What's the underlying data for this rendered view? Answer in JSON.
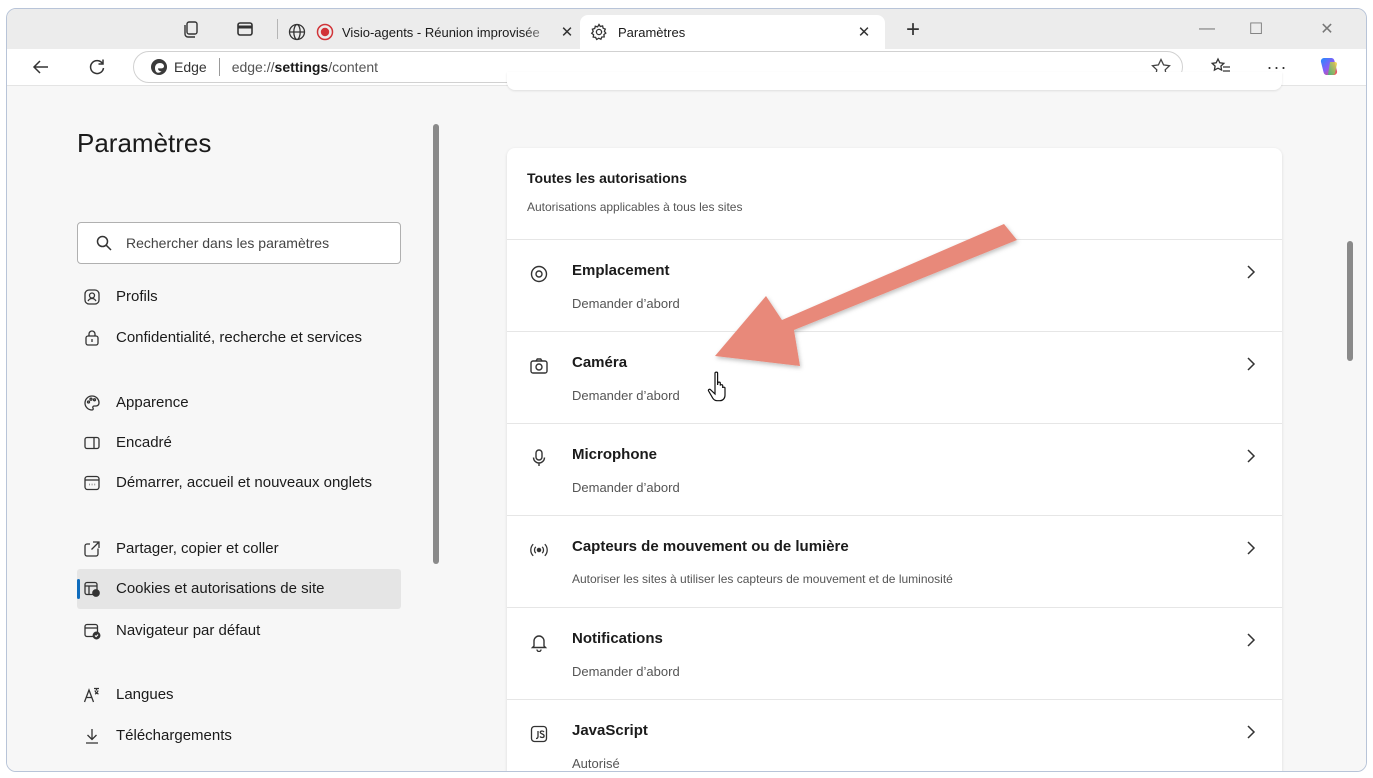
{
  "tabs": [
    {
      "title": "Visio-agents - Réunion improvisée",
      "active": false
    },
    {
      "title": "Paramètres",
      "active": true
    }
  ],
  "toolbar": {
    "omnibox_brand": "Edge",
    "url_prefix": "edge://",
    "url_bold": "settings",
    "url_suffix": "/content"
  },
  "sidebar": {
    "title": "Paramètres",
    "search_placeholder": "Rechercher dans les paramètres",
    "items": [
      {
        "label": "Profils",
        "icon": "profile-icon"
      },
      {
        "label": "Confidentialité, recherche et services",
        "icon": "lock-icon"
      },
      {
        "label": "Apparence",
        "icon": "palette-icon"
      },
      {
        "label": "Encadré",
        "icon": "sidebar-panel-icon"
      },
      {
        "label": "Démarrer, accueil et nouveaux onglets",
        "icon": "home-tab-icon"
      },
      {
        "label": "Partager, copier et coller",
        "icon": "share-icon"
      },
      {
        "label": "Cookies et autorisations de site",
        "icon": "cookie-permissions-icon",
        "active": true
      },
      {
        "label": "Navigateur par défaut",
        "icon": "default-browser-icon"
      },
      {
        "label": "Langues",
        "icon": "language-icon"
      },
      {
        "label": "Téléchargements",
        "icon": "download-icon"
      }
    ]
  },
  "card": {
    "title": "Toutes les autorisations",
    "subtitle": "Autorisations applicables à tous les sites",
    "rows": [
      {
        "title": "Emplacement",
        "status": "Demander d’abord",
        "icon": "location-icon"
      },
      {
        "title": "Caméra",
        "status": "Demander d’abord",
        "icon": "camera-icon"
      },
      {
        "title": "Microphone",
        "status": "Demander d’abord",
        "icon": "microphone-icon"
      },
      {
        "title": "Capteurs de mouvement ou de lumière",
        "status": "Autoriser les sites à utiliser les capteurs de mouvement et de luminosité",
        "icon": "sensors-icon"
      },
      {
        "title": "Notifications",
        "status": "Demander d’abord",
        "icon": "bell-icon"
      },
      {
        "title": "JavaScript",
        "status": "Autorisé",
        "icon": "javascript-icon"
      }
    ]
  },
  "colors": {
    "accent": "#0f6cbd",
    "annotation_arrow": "#e8897a",
    "recording_dot": "#d13438"
  }
}
